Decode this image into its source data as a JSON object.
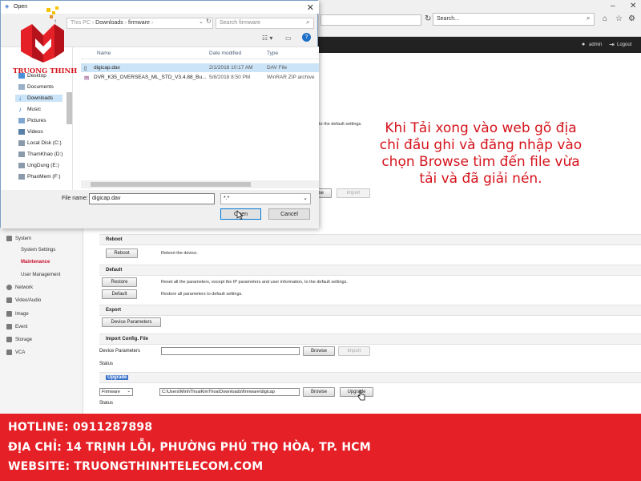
{
  "browser": {
    "search_placeholder": "Search...",
    "admin_label": "admin",
    "logout_label": "Logout"
  },
  "dialog": {
    "title": "Open",
    "breadcrumb": [
      "This PC",
      "Downloads",
      "firmware"
    ],
    "search_placeholder": "Search firmware",
    "columns": [
      "Name",
      "Date modified",
      "Type"
    ],
    "nav_items": [
      "Desktop",
      "Documents",
      "Downloads",
      "Music",
      "Pictures",
      "Videos",
      "Local Disk (C:)",
      "ThamKhao (D:)",
      "UngDung (E:)",
      "PhanMem (F:)"
    ],
    "files": [
      {
        "name": "digicap.dav",
        "date": "2/1/2018 10:17 AM",
        "type": "DAV File",
        "selected": true
      },
      {
        "name": "DVR_K35_OVERSEAS_ML_STD_V3.4.88_Bu...",
        "date": "5/8/2018 8:50 PM",
        "type": "WinRAR ZIP archive",
        "selected": false
      }
    ],
    "filename_label": "File name:",
    "filename_value": "digicap.dav",
    "filter_value": "*.*",
    "open_label": "Open",
    "cancel_label": "Cancel"
  },
  "logo": {
    "brand": "TRUONG THINH"
  },
  "sidebar": {
    "items": [
      {
        "label": "System",
        "icon": "system-icon"
      },
      {
        "label": "System Settings",
        "sub": true
      },
      {
        "label": "Maintenance",
        "sub": true,
        "active": true
      },
      {
        "label": "User Management",
        "sub": true
      },
      {
        "label": "Network",
        "icon": "network-icon"
      },
      {
        "label": "Video/Audio",
        "icon": "video-icon"
      },
      {
        "label": "Image",
        "icon": "image-icon"
      },
      {
        "label": "Event",
        "icon": "event-icon"
      },
      {
        "label": "Storage",
        "icon": "storage-icon"
      },
      {
        "label": "VCA",
        "icon": "vca-icon"
      }
    ]
  },
  "main": {
    "partial_text": "to the default settings.",
    "browse_label": "Browse",
    "import_label": "Import",
    "reboot": {
      "title": "Reboot",
      "button": "Reboot",
      "desc": "Reboot the device."
    },
    "default": {
      "title": "Default",
      "restore_button": "Restore",
      "restore_desc": "Reset all the parameters, except the IP parameters and user information, to the default settings.",
      "default_button": "Default",
      "default_desc": "Restore all parameters to default settings."
    },
    "export": {
      "title": "Export",
      "button": "Device Parameters"
    },
    "import_config": {
      "title": "Import Config. File",
      "label": "Device Parameters",
      "browse": "Browse",
      "import": "Import",
      "status": "Status"
    },
    "upgrade": {
      "title": "Upgrade",
      "type": "Firmware",
      "path": "C:\\Users\\MinhThoaiKimThoa\\Downloads\\firmware\\digicap",
      "browse": "Browse",
      "button": "Upgrade",
      "status": "Status"
    }
  },
  "caption": {
    "lines": [
      "Khi Tải xong vào web gõ địa",
      "chỉ đầu ghi và đăng nhập vào",
      "chọn Browse tìm đến file vừa",
      "tải và đã giải nén."
    ]
  },
  "footer": {
    "hotline": "HOTLINE: 0911287898",
    "address": "ĐỊA CHỈ: 14 TRỊNH LỖI, PHƯỜNG PHÚ THỌ HÒA, TP. HCM",
    "website": "WEBSITE: TRUONGTHINHTELECOM.COM"
  },
  "colors": {
    "accent_red": "#e52027",
    "caption_red": "#d4141c",
    "selection_blue": "#cce4f7"
  }
}
